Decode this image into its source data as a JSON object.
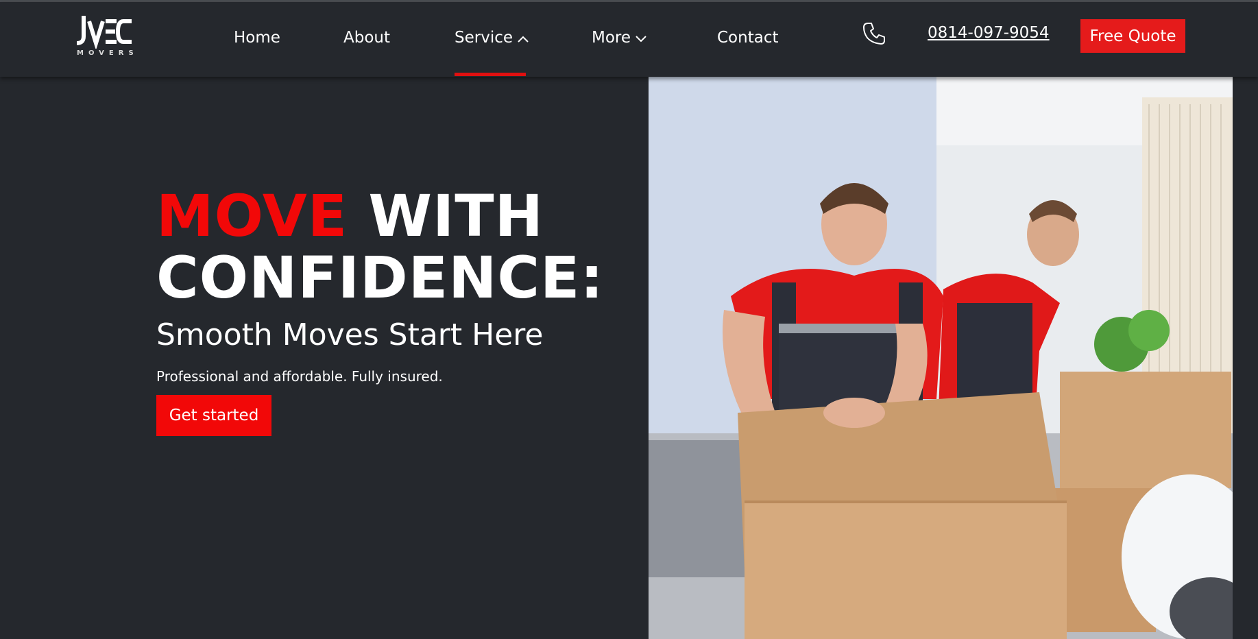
{
  "brand": {
    "logo_text": "JVEC",
    "logo_subtext": "MOVERS"
  },
  "nav": {
    "items": [
      {
        "label": "Home"
      },
      {
        "label": "About"
      },
      {
        "label": "Service",
        "icon": "chevron-up-icon",
        "active": true
      },
      {
        "label": "More",
        "icon": "chevron-down-icon"
      },
      {
        "label": "Contact"
      }
    ],
    "phone": "0814-097-9054",
    "phone_icon": "phone-icon",
    "quote_label": "Free Quote"
  },
  "hero": {
    "title_highlight": "MOVE",
    "title_rest_1": "WITH",
    "title_rest_2": "CONFIDENCE:",
    "subtitle": "Smooth Moves Start Here",
    "description": "Professional and affordable. Fully insured.",
    "cta_label": "Get started",
    "image_alt": "Two movers in red shirts and overalls packing cardboard boxes"
  },
  "colors": {
    "background": "#25282d",
    "accent": "#f20808",
    "button": "#e51b1b"
  }
}
